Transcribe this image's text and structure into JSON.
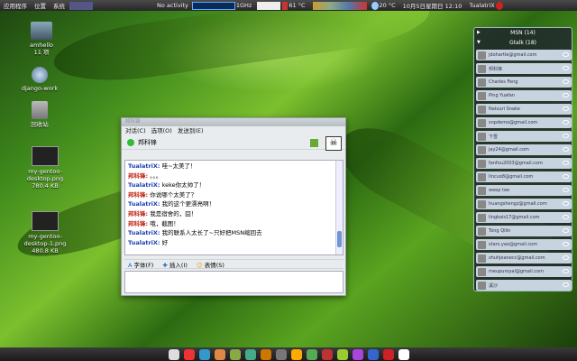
{
  "topbar": {
    "menus": [
      "应用程序",
      "位置",
      "系统"
    ],
    "activity": "No activity",
    "cpu_freq": "1GHz",
    "temp_cpu": "61 °C",
    "weather": "20 °C",
    "clock": "10月5日星期日 12:10",
    "user": "TualatriX"
  },
  "desktop": {
    "icons": [
      {
        "label": "amhello",
        "sub": "11 项"
      },
      {
        "label": "django-work",
        "sub": ""
      },
      {
        "label": "回收站",
        "sub": ""
      },
      {
        "label": "my-gentoo-desktop.png",
        "sub": "780.4 KB"
      },
      {
        "label": "my-gentoo-desktop-1.png",
        "sub": "480.8 KB"
      }
    ]
  },
  "chat": {
    "title": "邦科锋",
    "menu": [
      "对话(C)",
      "选项(O)",
      "发送到(E)"
    ],
    "contact_name": "邦科锋",
    "messages": [
      {
        "name": "TualatriX:",
        "text": "哇~太美了！",
        "who": "a"
      },
      {
        "name": "邦科锋:",
        "text": "。。。",
        "who": "b"
      },
      {
        "name": "TualatriX:",
        "text": "keke你太帅了！",
        "who": "a"
      },
      {
        "name": "邦科锋:",
        "text": "你说哪个太美了？",
        "who": "b"
      },
      {
        "name": "TualatriX:",
        "text": "我的这个更漂亮啊！",
        "who": "a"
      },
      {
        "name": "邦科锋:",
        "text": "我是宿舍的，囧！",
        "who": "b"
      },
      {
        "name": "邦科锋:",
        "text": "哦，截图！",
        "who": "b"
      },
      {
        "name": "TualatriX:",
        "text": "我的联系人太长了~只好把MSN缩回去",
        "who": "a"
      },
      {
        "name": "TualatriX:",
        "text": "好",
        "who": "a"
      }
    ],
    "toolbar": [
      "字体(F)",
      "插入(I)",
      "表情(S)"
    ]
  },
  "buddy": {
    "msn": "MSN (14)",
    "gtalk": "Gtalk (18)",
    "contacts": [
      "jdohartle@gmail.com",
      "邦科锋",
      "Charles Feng",
      "Ping Yuafan",
      "Natsuri Snake",
      "snpdemo@gmail.com",
      "下雪",
      "jay24@gmail.com",
      "fanfou2003@gmail.com",
      "lincuo8@gmail.com",
      "weep tee",
      "huangshengz@gmail.com",
      "lingkais17@gmail.com",
      "Tong Qilin",
      "stars.yao@gmail.com",
      "zhuhjeanecc@gmail.com",
      "meupuroyal@gmail.com",
      "溪沙"
    ]
  }
}
